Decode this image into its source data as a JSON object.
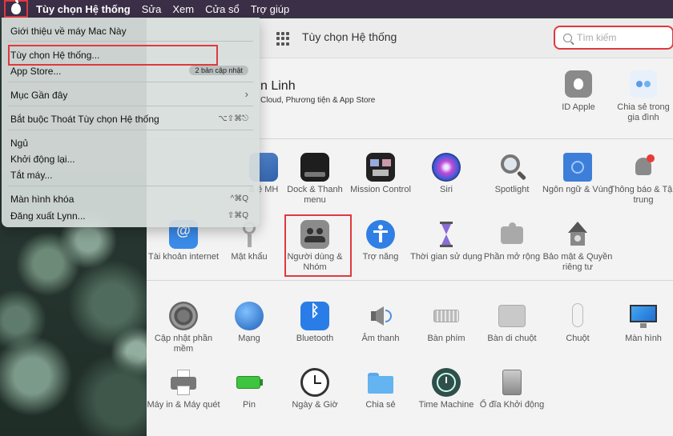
{
  "menubar": {
    "app_name": "Tùy chọn Hệ thống",
    "items": [
      "Sửa",
      "Xem",
      "Cửa sổ",
      "Trợ giúp"
    ]
  },
  "apple_menu": {
    "about": "Giới thiệu về máy Mac Này",
    "system_prefs": "Tùy chọn Hệ thống...",
    "app_store": "App Store...",
    "app_store_badge": "2 bản cập nhật",
    "recent": "Mục Gần đây",
    "force_quit": "Bắt buộc Thoát Tùy chọn Hệ thống",
    "force_quit_shortcut": "⌥⇧⌘⎋",
    "sleep": "Ngủ",
    "restart": "Khởi động lại...",
    "shutdown": "Tắt máy...",
    "lock_screen": "Màn hình khóa",
    "lock_shortcut": "^⌘Q",
    "logout": "Đăng xuất Lynn...",
    "logout_shortcut": "⇧⌘Q"
  },
  "window": {
    "title": "Tùy chọn Hệ thống",
    "search_placeholder": "Tìm kiếm",
    "user_name": "n Linh",
    "user_subtitle": "Cloud, Phương tiện & App Store",
    "top_prefs": [
      {
        "label": "ID Apple"
      },
      {
        "label": "Chia sẻ trong gia đình"
      }
    ],
    "row1": [
      {
        "label": "& ệ MH"
      },
      {
        "label": "Dock & Thanh menu"
      },
      {
        "label": "Mission Control"
      },
      {
        "label": "Siri"
      },
      {
        "label": "Spotlight"
      },
      {
        "label": "Ngôn ngữ & Vùng"
      },
      {
        "label": "Thông báo & Tập trung"
      }
    ],
    "row2": [
      {
        "label": "Tài khoản internet"
      },
      {
        "label": "Mật khẩu"
      },
      {
        "label": "Người dùng & Nhóm"
      },
      {
        "label": "Trợ năng"
      },
      {
        "label": "Thời gian sử dụng"
      },
      {
        "label": "Phần mở rộng"
      },
      {
        "label": "Bảo mật & Quyền riêng tư"
      }
    ],
    "row3": [
      {
        "label": "Cập nhật phần mềm"
      },
      {
        "label": "Mạng"
      },
      {
        "label": "Bluetooth"
      },
      {
        "label": "Âm thanh"
      },
      {
        "label": "Bàn phím"
      },
      {
        "label": "Bàn di chuột"
      },
      {
        "label": "Chuột"
      },
      {
        "label": "Màn hình"
      }
    ],
    "row4": [
      {
        "label": "Máy in & Máy quét"
      },
      {
        "label": "Pin"
      },
      {
        "label": "Ngày & Giờ"
      },
      {
        "label": "Chia sẻ"
      },
      {
        "label": "Time Machine"
      },
      {
        "label": "Ổ đĩa Khởi động"
      }
    ]
  },
  "colors": {
    "menubar": "#3a2f46",
    "highlight": "#e0393e",
    "window_bg": "#f3f3f3"
  }
}
